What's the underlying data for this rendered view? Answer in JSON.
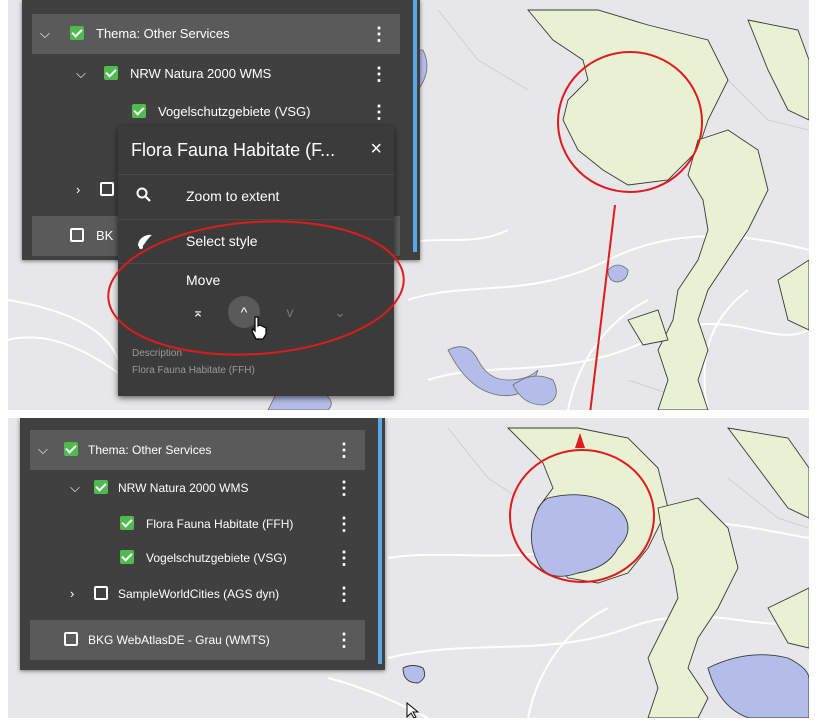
{
  "colors": {
    "panel": "#404040",
    "group_row": "#5a5a5a",
    "checkbox_on": "#4fbb4f",
    "scrollbar": "#58a9e6",
    "highlight": "#e01b1b",
    "land": "#e8f1d3",
    "water": "#b4bce9",
    "map_bg": "#e7e6e8"
  },
  "top": {
    "tree": {
      "theme_row": "Thema: Other Services",
      "wms_row": "NRW Natura 2000 WMS",
      "vsg_row": "Vogelschutzgebiete (VSG)",
      "bkg_row_partial": "BK"
    },
    "menu": {
      "title": "Flora Fauna Habitate (F...",
      "close_icon": "×",
      "zoom_label": "Zoom to extent",
      "style_label": "Select style",
      "move_label": "Move",
      "move_top_icon": "⌅",
      "move_up_icon": "^",
      "move_down_icon": "v",
      "move_bottom_icon": "⌄",
      "description_label": "Description",
      "description_value": "Flora Fauna Habitate (FFH)"
    }
  },
  "bottom": {
    "tree": {
      "theme_row": "Thema: Other Services",
      "wms_row": "NRW Natura 2000 WMS",
      "ffh_row": "Flora Fauna Habitate (FFH)",
      "vsg_row": "Vogelschutzgebiete (VSG)",
      "sample_row": "SampleWorldCities (AGS dyn)",
      "bkg_row": "BKG WebAtlasDE - Grau (WMTS)"
    }
  },
  "icons": {
    "chevron_down": "chevron-down-icon",
    "chevron_right": "chevron-right-icon",
    "kebab": "kebab-icon",
    "search": "search-icon",
    "palette": "palette-icon",
    "close": "close-icon"
  }
}
